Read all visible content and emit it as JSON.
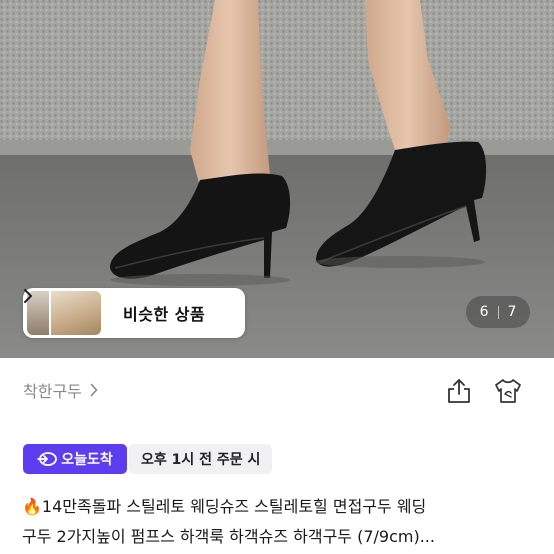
{
  "similar_products": {
    "label": "비슷한 상품"
  },
  "gallery": {
    "current": "6",
    "total": "7"
  },
  "seller": {
    "name": "착한구두"
  },
  "delivery": {
    "badge_label": "오늘도착",
    "order_info": "오후 1시 전 주문 시"
  },
  "product": {
    "title_line1": "🔥14만족돌파 스틸레토 웨딩슈즈 스틸레토힐 면접구두 웨딩",
    "title_line2": "구두 2가지높이 펌프스 하객룩 하객슈즈 하객구두 (7/9cm)..."
  },
  "colors": {
    "badge": "#5d3df0",
    "order_bg": "#f1f1f3",
    "seller_text": "#888888"
  }
}
